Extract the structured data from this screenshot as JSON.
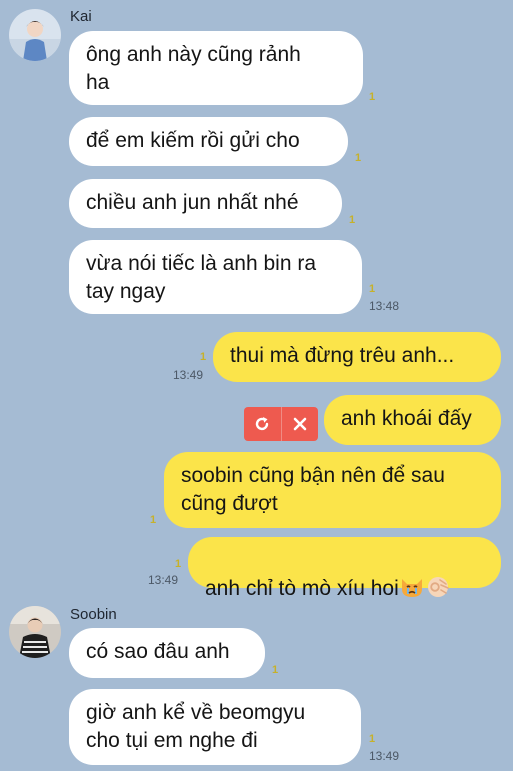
{
  "chat": {
    "participants": [
      {
        "name": "Kai"
      },
      {
        "name": "Soobin"
      }
    ],
    "messages": [
      {
        "text": "ông anh này cũng rảnh\nha",
        "unread": "1"
      },
      {
        "text": "để em kiếm rồi gửi cho",
        "unread": "1"
      },
      {
        "text": "chiều anh jun nhất nhé",
        "unread": "1"
      },
      {
        "text": "vừa nói tiếc là anh bin ra\ntay ngay",
        "unread": "1",
        "time": "13:48"
      },
      {
        "text": "thui mà đừng trêu anh...",
        "unread": "1",
        "time": "13:49"
      },
      {
        "text": "anh khoái đấy"
      },
      {
        "text": "soobin cũng bận nên để sau\ncũng đượt",
        "unread": "1"
      },
      {
        "text": "anh chỉ tò mò xíu hoi",
        "unread": "1",
        "time": "13:49"
      },
      {
        "text": "có sao đâu anh",
        "unread": "1"
      },
      {
        "text": "giờ anh kể về beomgyu\ncho tụi em nghe đi",
        "unread": "1",
        "time": "13:49"
      }
    ],
    "failed_actions": {
      "retry_icon": "refresh-icon",
      "delete_icon": "close-icon"
    },
    "emoji": [
      "crying-cat-emoji",
      "ok-hand-emoji"
    ],
    "colors": {
      "background": "#a5bbd3",
      "incoming": "#ffffff",
      "outgoing": "#fbe44a",
      "unread": "#c6b12a",
      "failed": "#ee5a4f"
    }
  }
}
